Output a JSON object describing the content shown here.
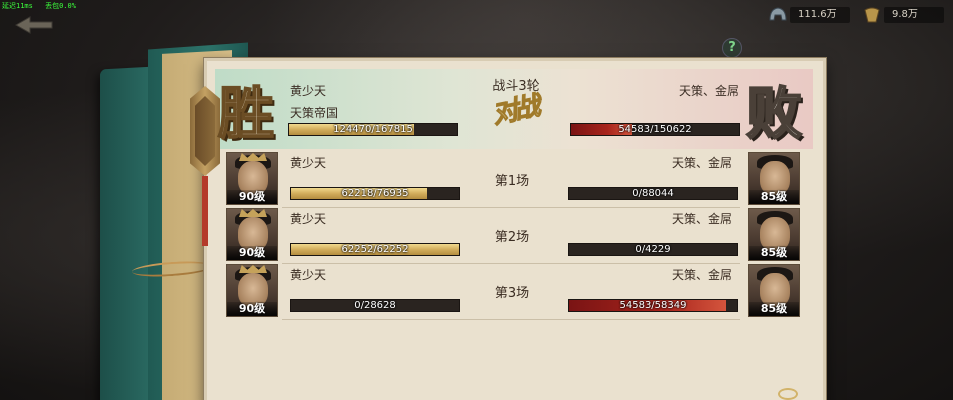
{
  "debug": {
    "ping": "延迟11ms",
    "loss": "丢包0.0%"
  },
  "resources": [
    {
      "icon": "helmet-icon",
      "value": "111.6万"
    },
    {
      "icon": "coin-icon",
      "value": "9.8万"
    }
  ],
  "help_label": "?",
  "header": {
    "round_title": "战斗3轮",
    "vs_text": "对战",
    "left": {
      "result": "胜",
      "player_name": "黄少天",
      "faction": "天策帝国",
      "hp_text": "124470/167815",
      "hp_current": 124470,
      "hp_max": 167815
    },
    "right": {
      "result": "败",
      "player_name": "天策、金屌",
      "hp_text": "54583/150622",
      "hp_current": 54583,
      "hp_max": 150622
    }
  },
  "matches": [
    {
      "label": "第1场",
      "left": {
        "name": "黄少天",
        "level": "90级",
        "hp_text": "62218/76935",
        "hp_current": 62218,
        "hp_max": 76935,
        "bar_color": "gold"
      },
      "right": {
        "name": "天策、金屌",
        "level": "85级",
        "hp_text": "0/88044",
        "hp_current": 0,
        "hp_max": 88044
      }
    },
    {
      "label": "第2场",
      "left": {
        "name": "黄少天",
        "level": "90级",
        "hp_text": "62252/62252",
        "hp_current": 62252,
        "hp_max": 62252,
        "bar_color": "gold"
      },
      "right": {
        "name": "天策、金屌",
        "level": "85级",
        "hp_text": "0/4229",
        "hp_current": 0,
        "hp_max": 4229
      }
    },
    {
      "label": "第3场",
      "left": {
        "name": "黄少天",
        "level": "90级",
        "hp_text": "0/28628",
        "hp_current": 0,
        "hp_max": 28628,
        "bar_color": "orange"
      },
      "right": {
        "name": "天策、金屌",
        "level": "85级",
        "hp_text": "54583/58349",
        "hp_current": 54583,
        "hp_max": 58349
      }
    }
  ],
  "colors": {
    "win_bar": "#d2ad5c",
    "lose_bar": "#a8241c",
    "panel_bg": "#eae1cf"
  }
}
